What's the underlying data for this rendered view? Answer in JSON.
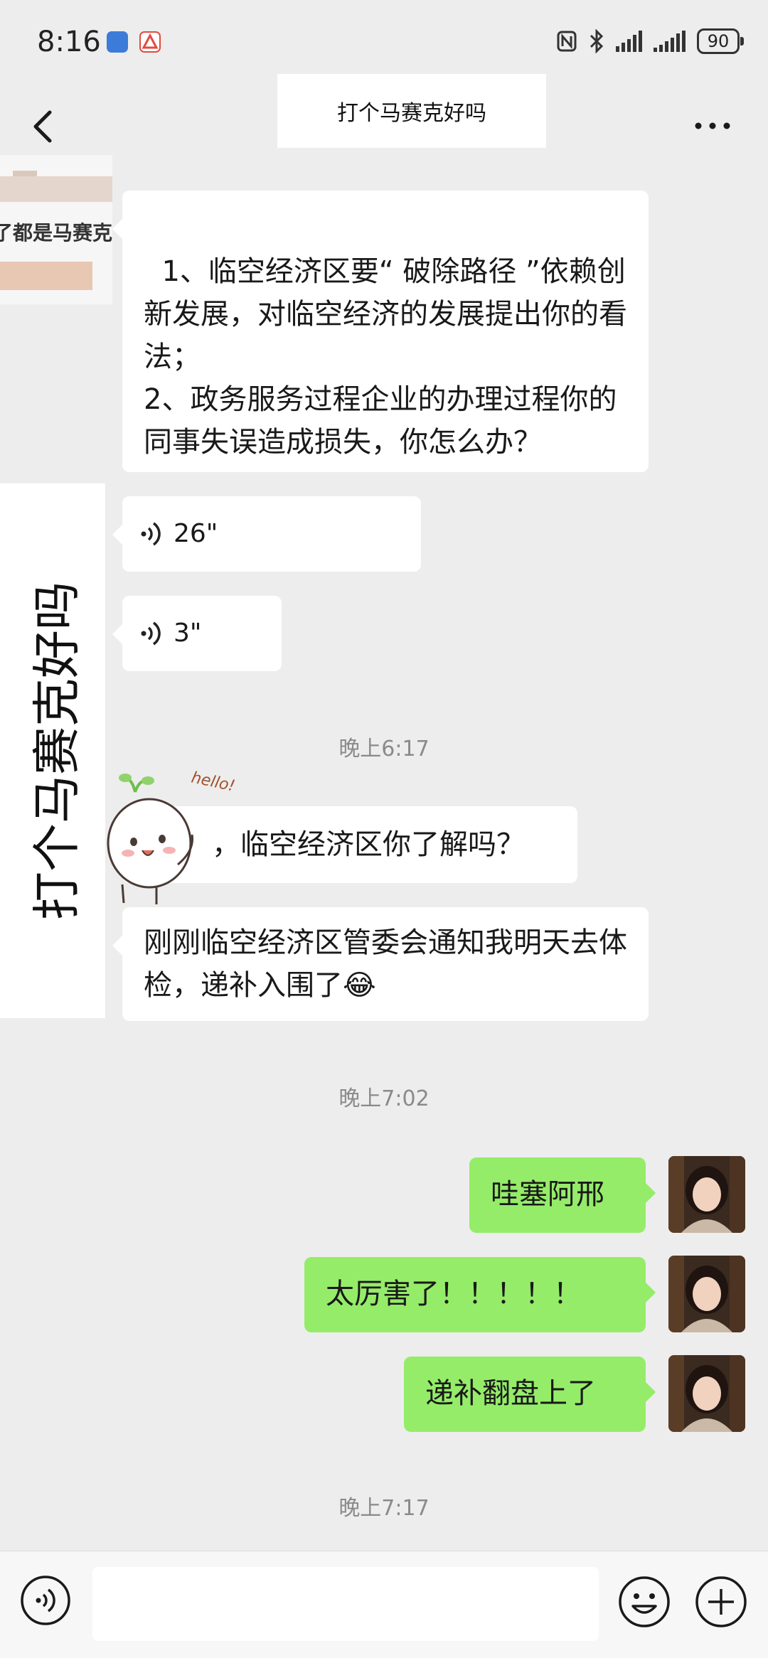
{
  "status_bar": {
    "time": "8:16",
    "battery": "90"
  },
  "chat": {
    "title": "打个马赛克好吗"
  },
  "stickers": {
    "top_text": "了都是马赛克",
    "vertical_text": "打个马赛克好吗",
    "hello_text": "hello!"
  },
  "messages": {
    "m1": "1、临空经济区要“ 破除路径 ”依赖创新发展，对临空经济的发展提出你的看法；\n2、政务服务过程企业的办理过程你的同事失误造成损失，你怎么办？",
    "voice1": "26\"",
    "voice2": "3\"",
    "ts1": "晚上6:17",
    "m2": "，临空经济区你了解吗？",
    "m3": "刚刚临空经济区管委会通知我明天去体检，递补入围了😂",
    "ts2": "晚上7:02",
    "m4": "哇塞阿邢",
    "m5": "太厉害了！！！！！",
    "m6": "递补翻盘上了",
    "ts3": "晚上7:17"
  },
  "input": {
    "placeholder": ""
  },
  "colors": {
    "background": "#ededed",
    "sent_bubble": "#95ec69",
    "received_bubble": "#ffffff"
  }
}
